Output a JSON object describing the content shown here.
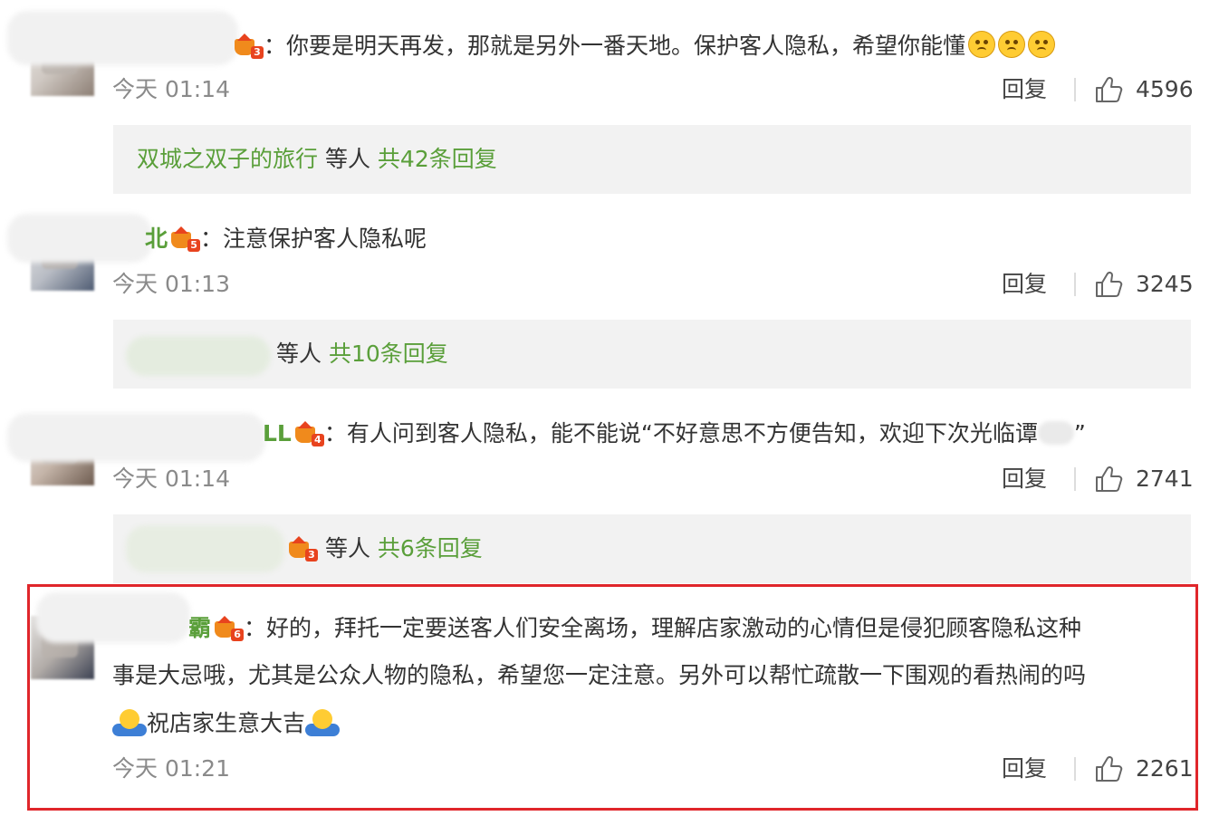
{
  "comments": [
    {
      "name_fragment": "",
      "level": "3",
      "text": "：你要是明天再发，那就是另外一番天地。保护客人隐私，希望你能懂",
      "emoji_count": 3,
      "time": "今天 01:14",
      "reply_label": "回复",
      "likes": "4596",
      "replies": {
        "prefix": "双城之双子的旅行",
        "middle": " 等人 ",
        "suffix": "共42条回复"
      }
    },
    {
      "name_fragment": "北",
      "level": "5",
      "text": "：注意保护客人隐私呢",
      "time": "今天 01:13",
      "reply_label": "回复",
      "likes": "3245",
      "replies": {
        "prefix": "",
        "middle": " 等人 ",
        "suffix": "共10条回复"
      }
    },
    {
      "name_fragment": "LL",
      "level": "4",
      "text": "：有人问到客人隐私，能不能说“不好意思不方便告知，欢迎下次光临谭",
      "text_tail": "”",
      "time": "今天 01:14",
      "reply_label": "回复",
      "likes": "2741",
      "replies": {
        "prefix": "",
        "level": "3",
        "middle": " 等人 ",
        "suffix": "共6条回复"
      }
    },
    {
      "name_fragment": "霸",
      "level": "6",
      "text_line1": "：好的，拜托一定要送客人们安全离场，理解店家激动的心情但是侵犯顾客隐私这种",
      "text_line2": "事是大忌哦，尤其是公众人物的隐私，希望您一定注意。另外可以帮忙疏散一下围观的看热闹的吗",
      "text_line3": "祝店家生意大吉",
      "time": "今天 01:21",
      "reply_label": "回复",
      "likes": "2261"
    }
  ],
  "colors": {
    "username_green": "#5a9f3a",
    "highlight_border": "#e0262b",
    "reply_box_bg": "#f2f2f2",
    "time_gray": "#8a8a8a"
  },
  "icons": [
    "thumbs-up-icon",
    "level-crown-icon",
    "upside-down-face-icon",
    "hug-emoji-icon"
  ]
}
